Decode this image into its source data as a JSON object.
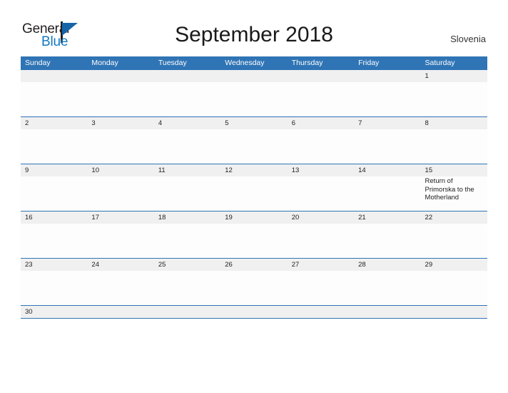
{
  "header": {
    "logo": {
      "word_one": "General",
      "word_two": "Blue",
      "flag_icon": "triangle-flag-icon",
      "blue_hex": "#1479bf",
      "flag_hex": "#1565a8"
    },
    "title": "September 2018",
    "country": "Slovenia"
  },
  "calendar": {
    "accent_hex": "#2f74b5",
    "date_strip_hex": "#f0f0f0",
    "weekdays": [
      "Sunday",
      "Monday",
      "Tuesday",
      "Wednesday",
      "Thursday",
      "Friday",
      "Saturday"
    ],
    "weeks": [
      {
        "days": [
          {
            "num": "",
            "event": ""
          },
          {
            "num": "",
            "event": ""
          },
          {
            "num": "",
            "event": ""
          },
          {
            "num": "",
            "event": ""
          },
          {
            "num": "",
            "event": ""
          },
          {
            "num": "",
            "event": ""
          },
          {
            "num": "1",
            "event": ""
          }
        ]
      },
      {
        "days": [
          {
            "num": "2",
            "event": ""
          },
          {
            "num": "3",
            "event": ""
          },
          {
            "num": "4",
            "event": ""
          },
          {
            "num": "5",
            "event": ""
          },
          {
            "num": "6",
            "event": ""
          },
          {
            "num": "7",
            "event": ""
          },
          {
            "num": "8",
            "event": ""
          }
        ]
      },
      {
        "days": [
          {
            "num": "9",
            "event": ""
          },
          {
            "num": "10",
            "event": ""
          },
          {
            "num": "11",
            "event": ""
          },
          {
            "num": "12",
            "event": ""
          },
          {
            "num": "13",
            "event": ""
          },
          {
            "num": "14",
            "event": ""
          },
          {
            "num": "15",
            "event": "Return of Primorska to the Motherland"
          }
        ]
      },
      {
        "days": [
          {
            "num": "16",
            "event": ""
          },
          {
            "num": "17",
            "event": ""
          },
          {
            "num": "18",
            "event": ""
          },
          {
            "num": "19",
            "event": ""
          },
          {
            "num": "20",
            "event": ""
          },
          {
            "num": "21",
            "event": ""
          },
          {
            "num": "22",
            "event": ""
          }
        ]
      },
      {
        "days": [
          {
            "num": "23",
            "event": ""
          },
          {
            "num": "24",
            "event": ""
          },
          {
            "num": "25",
            "event": ""
          },
          {
            "num": "26",
            "event": ""
          },
          {
            "num": "27",
            "event": ""
          },
          {
            "num": "28",
            "event": ""
          },
          {
            "num": "29",
            "event": ""
          }
        ]
      },
      {
        "days": [
          {
            "num": "30",
            "event": ""
          },
          {
            "num": "",
            "event": ""
          },
          {
            "num": "",
            "event": ""
          },
          {
            "num": "",
            "event": ""
          },
          {
            "num": "",
            "event": ""
          },
          {
            "num": "",
            "event": ""
          },
          {
            "num": "",
            "event": ""
          }
        ]
      }
    ]
  }
}
